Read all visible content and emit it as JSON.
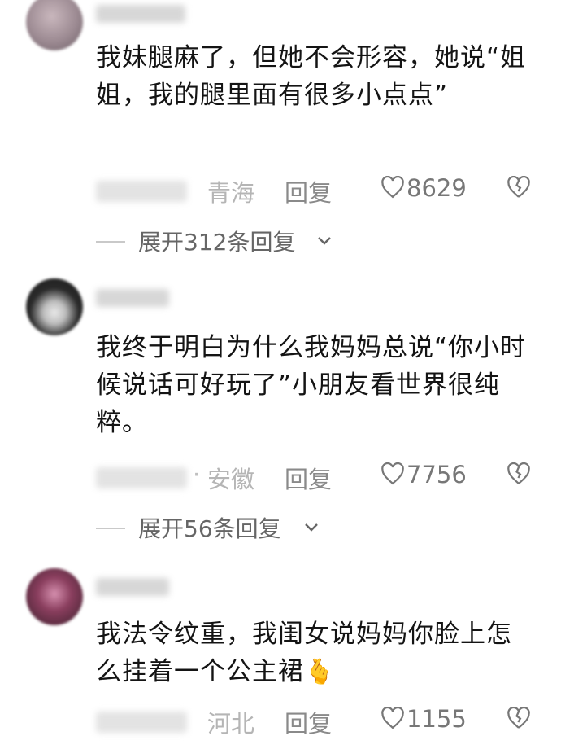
{
  "comments": [
    {
      "avatar_color": "#9c8a92",
      "text": "我妹腿麻了，但她不会形容，她说“姐姐，我的腿里面有很多小点点”",
      "location": "青海",
      "reply_label": "回复",
      "likes": "8629",
      "expand_label": "展开312条回复"
    },
    {
      "avatar_color": "#3c3c3c",
      "text": "我终于明白为什么我妈妈总说“你小时候说话可好玩了”小朋友看世界很纯粹。",
      "location": "安徽",
      "reply_label": "回复",
      "likes": "7756",
      "expand_label": "展开56条回复"
    },
    {
      "avatar_color": "#6b3a52",
      "text": "我法令纹重，我闺女说妈妈你脸上怎么挂着一个公主裙",
      "emoji": "🫰",
      "location": "河北",
      "reply_label": "回复",
      "likes": "1155"
    }
  ],
  "icons": {
    "like": "heart-outline-icon",
    "dislike": "broken-heart-icon",
    "expand": "chevron-down-icon"
  },
  "colors": {
    "text": "#141414",
    "meta": "#8a8a8a",
    "location": "#b5b5b5"
  }
}
